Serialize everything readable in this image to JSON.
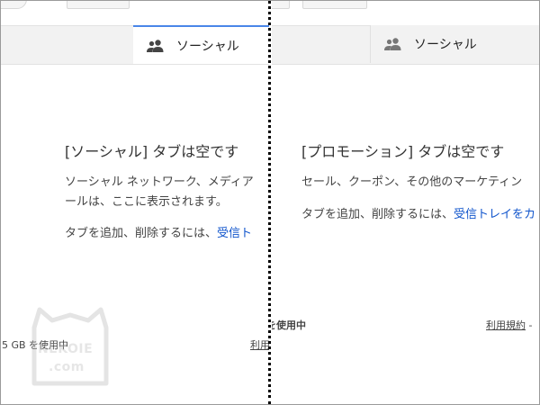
{
  "left_pane": {
    "tab_label": "ソーシャル",
    "empty_title": "[ソーシャル] タブは空です",
    "empty_desc_line1": "ソーシャル ネットワーク、メディア",
    "empty_desc_line2": "ールは、ここに表示されます。",
    "add_remove_prefix": "タブを追加、削除するには、",
    "add_remove_link": "受信ト",
    "storage_text": "5 GB を使用中",
    "terms_link": "利用"
  },
  "right_pane": {
    "tab_label": "ソーシャル",
    "empty_title": "[プロモーション] タブは空です",
    "empty_desc": "セール、クーポン、その他のマーケティン",
    "add_remove_prefix": "タブを追加、削除するには、",
    "add_remove_link": "受信トレイをカ",
    "storage_text": "を使用中",
    "terms_link": "利用規約",
    "terms_suffix": "-"
  },
  "watermark": {
    "line1": "NEKOIE",
    "line2": ".com"
  },
  "colors": {
    "active_tab_border": "#4a86e8",
    "link": "#1155cc",
    "tab_bar": "#f2f2f2"
  },
  "icons": {
    "tab_icon": "people-icon"
  }
}
